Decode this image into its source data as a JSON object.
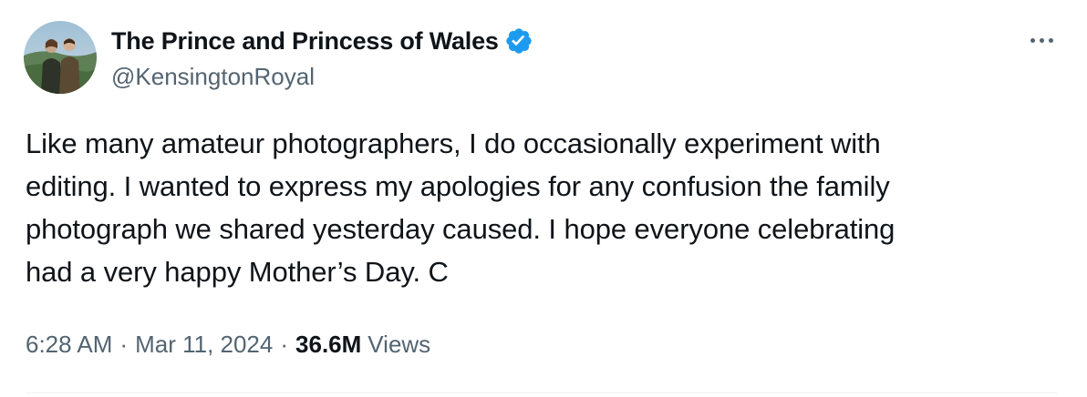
{
  "user": {
    "display_name": "The Prince and Princess of Wales",
    "handle": "@KensingtonRoyal",
    "verified": true,
    "avatar": "profile-photo-couple"
  },
  "tweet": {
    "text_lines": [
      "Like many amateur photographers, I do occasionally experiment with",
      "editing. I wanted to express my apologies for any confusion the family",
      "photograph we shared yesterday caused. I hope everyone celebrating",
      "had a very happy Mother’s Day. C"
    ]
  },
  "meta": {
    "time": "6:28 AM",
    "separator": "·",
    "date": "Mar 11, 2024",
    "views_count": "36.6M",
    "views_label": "Views"
  },
  "icons": {
    "verified": "verified-badge-icon",
    "more": "more-options-icon"
  },
  "colors": {
    "text_primary": "#0f1419",
    "text_secondary": "#536471",
    "verified_blue": "#1d9bf0",
    "divider": "#eff3f4"
  }
}
